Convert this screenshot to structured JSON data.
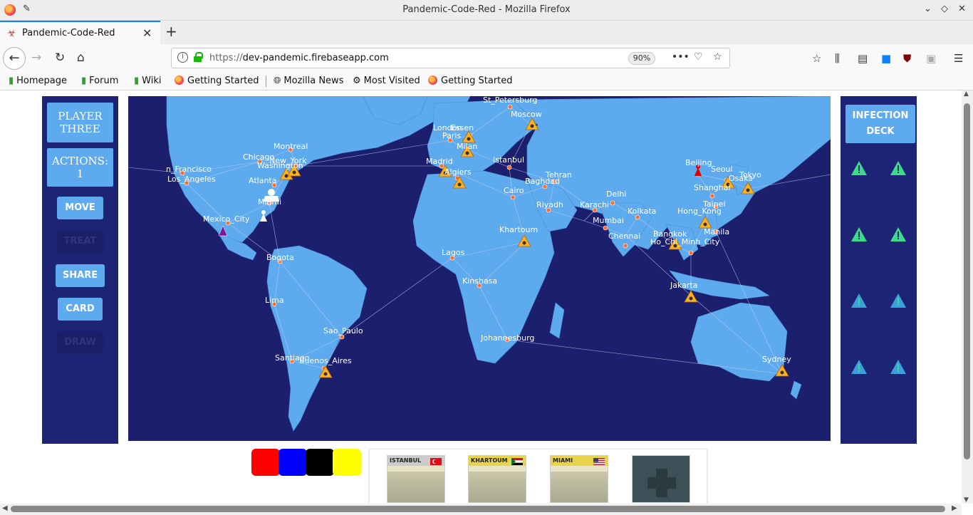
{
  "window": {
    "title": "Pandemic-Code-Red - Mozilla Firefox"
  },
  "tab": {
    "label": "Pandemic-Code-Red"
  },
  "urlbar": {
    "url_prefix": "https://",
    "url_host": "dev-pandemic.firebaseapp.com",
    "zoom": "90%"
  },
  "bookmarks": [
    "Homepage",
    "Forum",
    "Wiki",
    "Getting Started",
    "Mozilla News",
    "Most Visited",
    "Getting Started"
  ],
  "player": {
    "name_line1": "PLAYER",
    "name_line2": "THREE",
    "actions_label": "ACTIONS:",
    "actions_count": "1"
  },
  "action_buttons": [
    {
      "label": "MOVE",
      "enabled": true
    },
    {
      "label": "TREAT",
      "enabled": false
    },
    {
      "label": "SHARE",
      "enabled": true
    },
    {
      "label": "CARD",
      "enabled": true
    },
    {
      "label": "DRAW",
      "enabled": false
    }
  ],
  "infection_deck": {
    "line1": "INFECTION",
    "line2": "DECK"
  },
  "cure_colors": [
    "#ff0000",
    "#0000ff",
    "#000000",
    "#ffff00"
  ],
  "hand": [
    {
      "name": "ISTANBUL",
      "color": "#cccccc"
    },
    {
      "name": "KHARTOUM",
      "color": "#e8d44a"
    },
    {
      "name": "MIAMI",
      "color": "#e8d44a"
    },
    {
      "name": "",
      "color": "#3c5157"
    }
  ],
  "cities": {
    "St_Petersburg": "St_Petersburg",
    "Moscow": "Moscow",
    "London": "London",
    "Essen": "Essen",
    "Paris": "Paris",
    "Milan": "Milan",
    "Madrid": "Madrid",
    "Algiers": "Algiers",
    "Istanbul": "Istanbul",
    "Cairo": "Cairo",
    "Baghdad": "Baghdad",
    "Tehran": "Tehran",
    "Riyadh": "Riyadh",
    "Karachi": "Karachi",
    "Delhi": "Delhi",
    "Mumbai": "Mumbai",
    "Kolkata": "Kolkata",
    "Chennai": "Chennai",
    "Bangkok": "Bangkok",
    "Ho_Chi_Minh_City": "Ho_Chi_Minh_City",
    "Jakarta": "Jakarta",
    "Hong_Kong": "Hong_Kong",
    "Shanghai": "Shanghai",
    "Beijing": "Beijing",
    "Seoul": "Seoul",
    "Tokyo": "Tokyo",
    "Osaka": "Osaka",
    "Taipei": "Taipei",
    "Manila": "Manila",
    "Sydney": "Sydney",
    "San_Francisco": "n_Francisco",
    "Los_Angeles": "Los_Angeles",
    "Chicago": "Chicago",
    "Montreal": "Montreal",
    "New_York": "New_York",
    "Washington": "Washington",
    "Atlanta": "Atlanta",
    "Miami": "Miami",
    "Mexico_City": "Mexico_City",
    "Bogota": "Bogota",
    "Lima": "Lima",
    "Santiago": "Santiago",
    "Buenos_Aires": "Buenos_Aires",
    "Sao_Paulo": "Sao_Paulo",
    "Lagos": "Lagos",
    "Kinshasa": "Kinshasa",
    "Khartoum": "Khartoum",
    "Johannesburg": "Johannesburg"
  }
}
